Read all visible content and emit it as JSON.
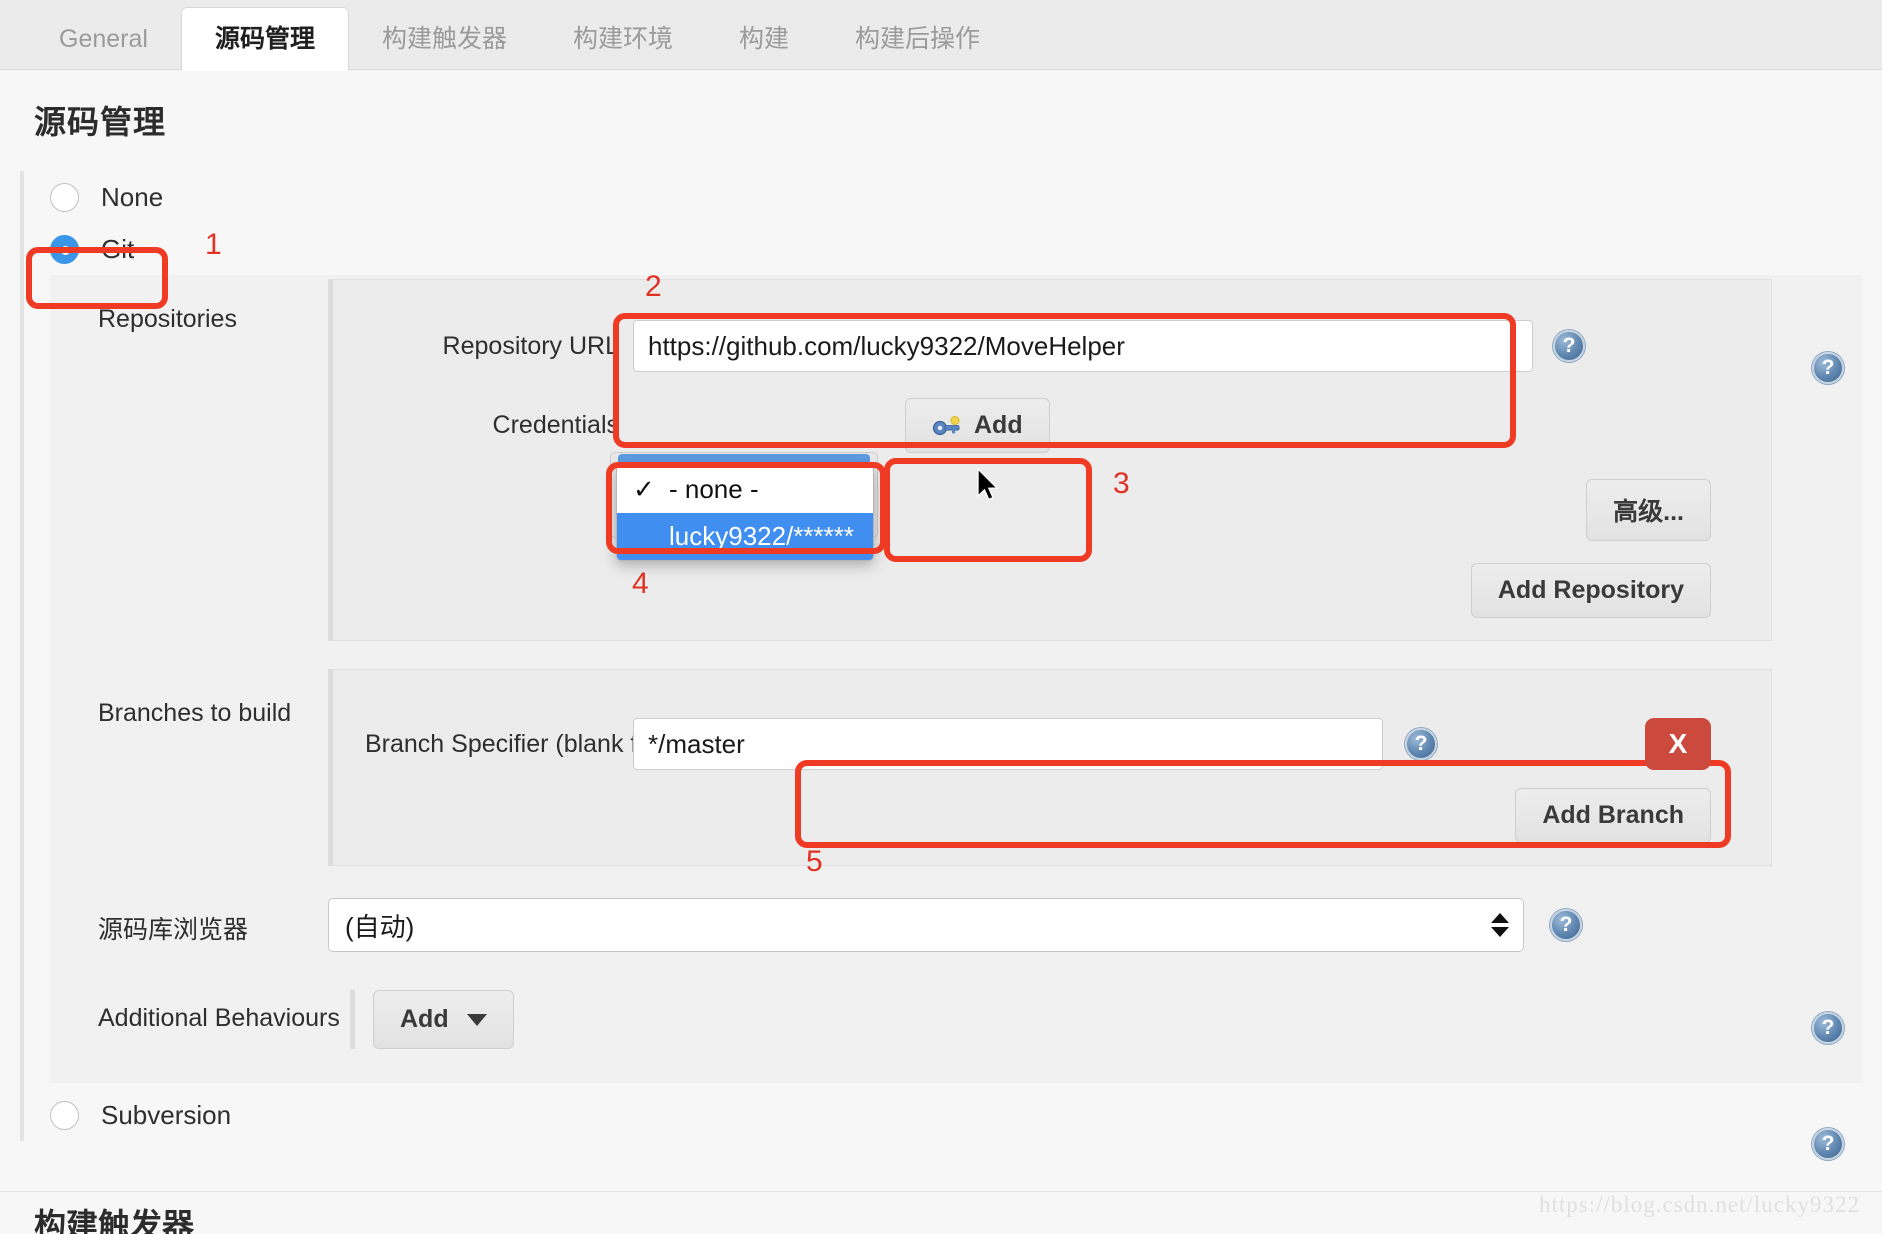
{
  "tabs": [
    {
      "label": "General",
      "active": false
    },
    {
      "label": "源码管理",
      "active": true
    },
    {
      "label": "构建触发器",
      "active": false
    },
    {
      "label": "构建环境",
      "active": false
    },
    {
      "label": "构建",
      "active": false
    },
    {
      "label": "构建后操作",
      "active": false
    }
  ],
  "page": {
    "title": "源码管理",
    "bottom_section_title": "构建触发器",
    "watermark": "https://blog.csdn.net/lucky9322"
  },
  "scm": {
    "none_label": "None",
    "git_label": "Git",
    "subversion_label": "Subversion"
  },
  "repositories": {
    "label": "Repositories",
    "url_label": "Repository URL",
    "url_value": "https://github.com/lucky9322/MoveHelper",
    "credentials_label": "Credentials",
    "add_credentials_label": "Add",
    "advanced_label": "高级...",
    "add_repository_label": "Add Repository",
    "credentials_options": [
      {
        "label": "- none -",
        "checked": true,
        "selected": false
      },
      {
        "label": "lucky9322/******",
        "checked": false,
        "selected": true
      }
    ]
  },
  "branches": {
    "label": "Branches to build",
    "specifier_label": "Branch Specifier (blank for 'any')",
    "specifier_value": "*/master",
    "add_branch_label": "Add Branch",
    "delete_label": "X"
  },
  "repo_browser": {
    "label": "源码库浏览器",
    "value": "(自动)"
  },
  "additional_behaviours": {
    "label": "Additional Behaviours",
    "add_label": "Add"
  },
  "annotations": {
    "n1": "1",
    "n2": "2",
    "n3": "3",
    "n4": "4",
    "n5": "5"
  },
  "colors": {
    "accent_blue": "#3b96e8",
    "annotation_red": "#ef3b24",
    "delete_red": "#cb4a3d",
    "select_highlight": "#3f8ef0"
  }
}
